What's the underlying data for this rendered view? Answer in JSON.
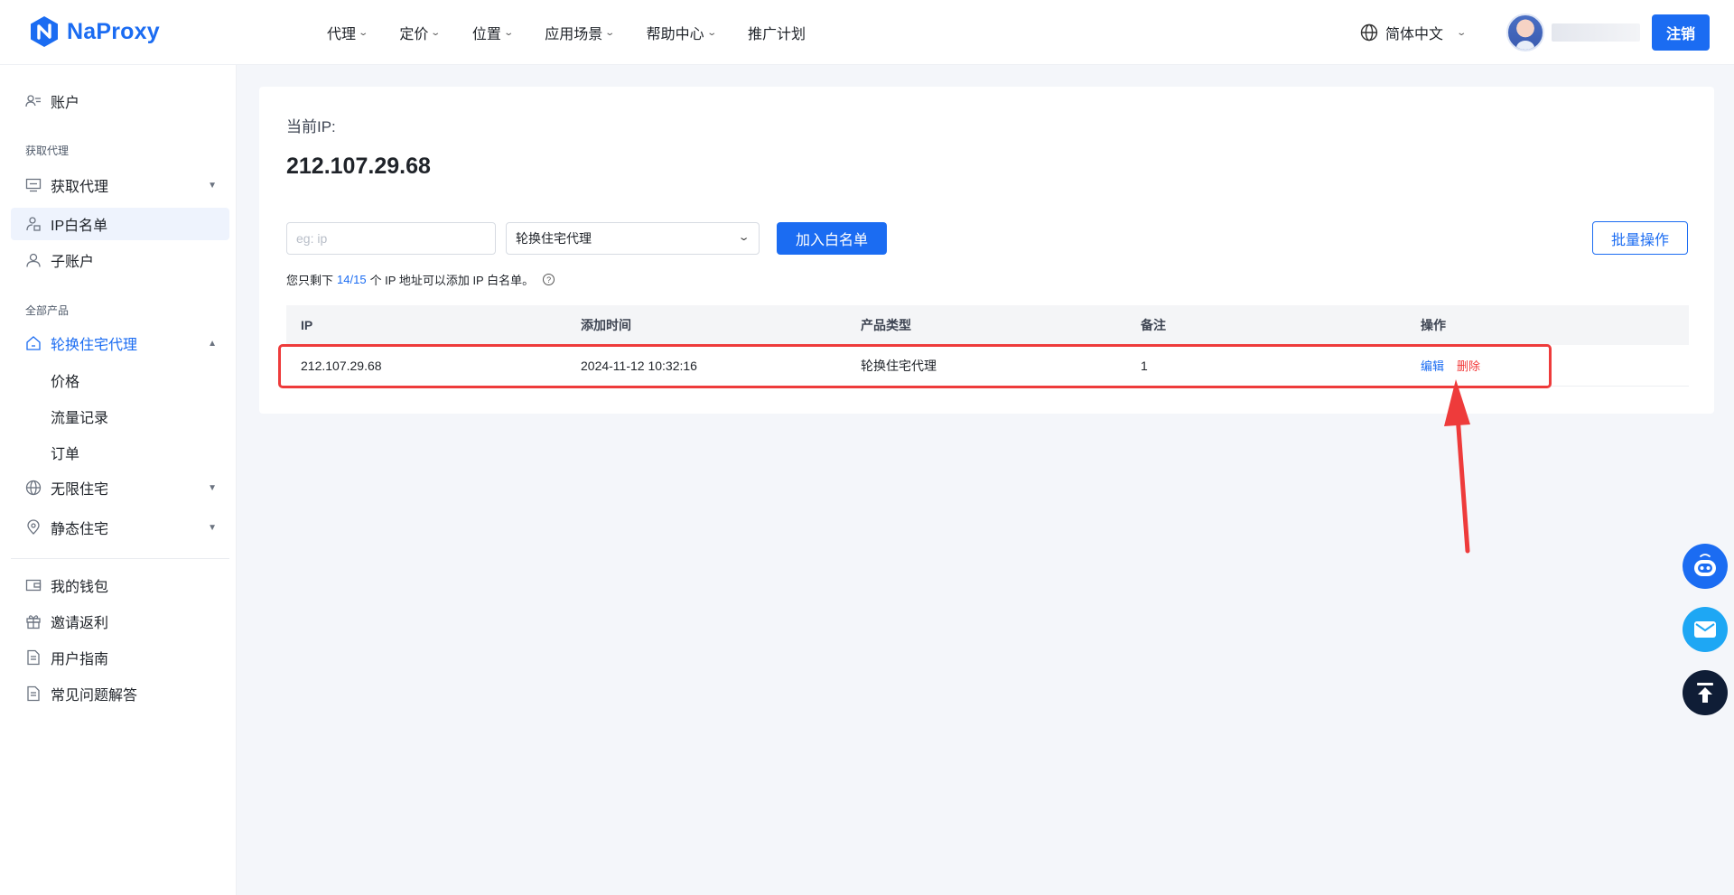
{
  "brand": {
    "name": "NaProxy"
  },
  "nav": {
    "items": [
      {
        "label": "代理"
      },
      {
        "label": "定价"
      },
      {
        "label": "位置"
      },
      {
        "label": "应用场景"
      },
      {
        "label": "帮助中心"
      },
      {
        "label": "推广计划"
      }
    ],
    "language": "简体中文",
    "logout": "注销"
  },
  "sidebar": {
    "account": "账户",
    "group_get_proxy": "获取代理",
    "get_proxy": "获取代理",
    "ip_whitelist": "IP白名单",
    "sub_account": "子账户",
    "group_all_products": "全部产品",
    "rotating_residential": "轮换住宅代理",
    "price": "价格",
    "traffic_records": "流量记录",
    "orders": "订单",
    "unlimited_residential": "无限住宅",
    "static_residential": "静态住宅",
    "wallet": "我的钱包",
    "invite_rebate": "邀请返利",
    "user_guide": "用户指南",
    "faq": "常见问题解答"
  },
  "main": {
    "current_ip_label": "当前IP:",
    "current_ip": "212.107.29.68",
    "ip_input_placeholder": "eg: ip",
    "product_select": "轮换住宅代理",
    "add_button": "加入白名单",
    "batch_button": "批量操作",
    "hint_prefix": "您只剩下",
    "hint_count": "14/15",
    "hint_suffix": "个 IP 地址可以添加 IP 白名单。",
    "help_icon": "?",
    "table": {
      "headers": [
        "IP",
        "添加时间",
        "产品类型",
        "备注",
        "操作"
      ],
      "rows": [
        {
          "ip": "212.107.29.68",
          "added": "2024-11-12 10:32:16",
          "product": "轮换住宅代理",
          "remark": "1",
          "edit": "编辑",
          "delete": "删除"
        }
      ]
    }
  },
  "colors": {
    "accent": "#1b6cf2",
    "danger": "#f23a3a",
    "annotation": "#ee3b3b"
  }
}
